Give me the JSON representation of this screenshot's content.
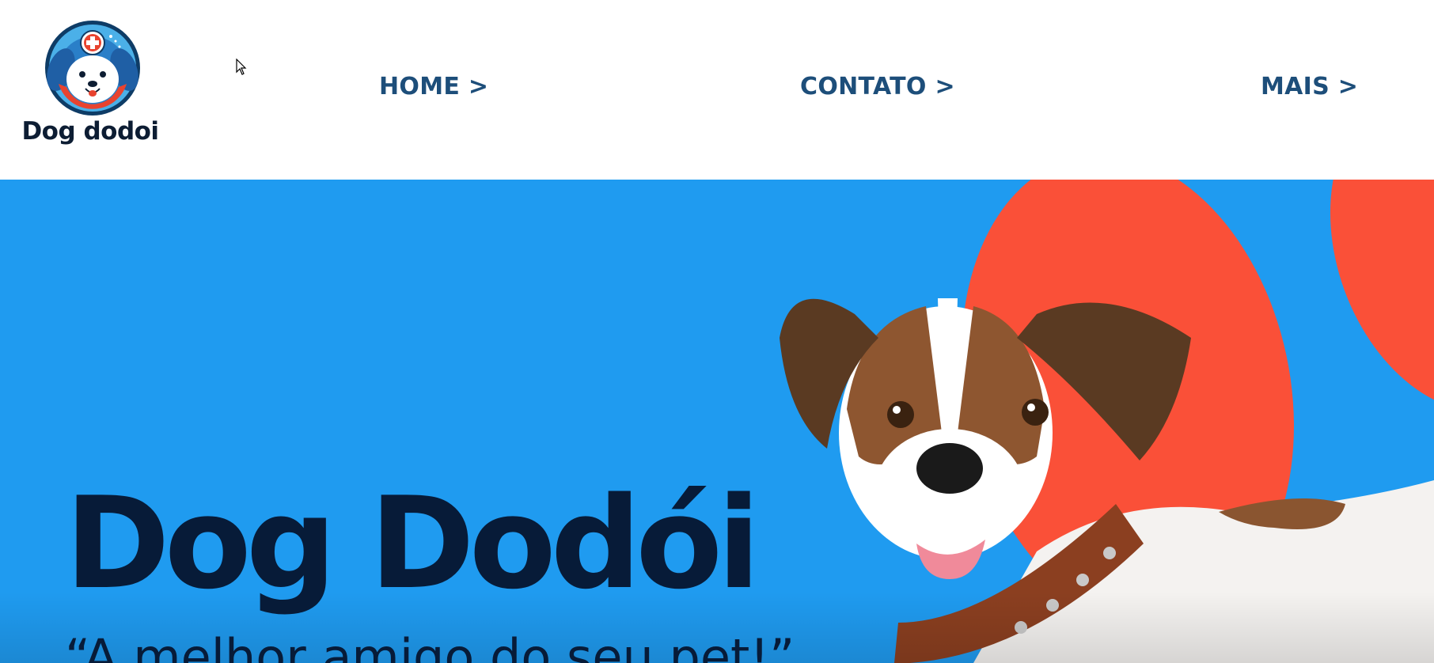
{
  "brand": {
    "logo_text": "Dog dodoi"
  },
  "nav": {
    "home": "HOME >",
    "contato": "CONTATO >",
    "mais": "MAIS >"
  },
  "hero": {
    "title": "Dog Dodói",
    "tagline": "“A melhor amigo do seu pet!”",
    "image": "dog-jack-russell-with-collar"
  },
  "colors": {
    "hero_background": "#1f9bf0",
    "accent_blob": "#fa5038",
    "title_text": "#071b38",
    "nav_text": "#1d4e7a"
  },
  "icons": {
    "logo": "dog-face-medical-cross-icon",
    "cursor": "mouse-pointer-icon"
  }
}
